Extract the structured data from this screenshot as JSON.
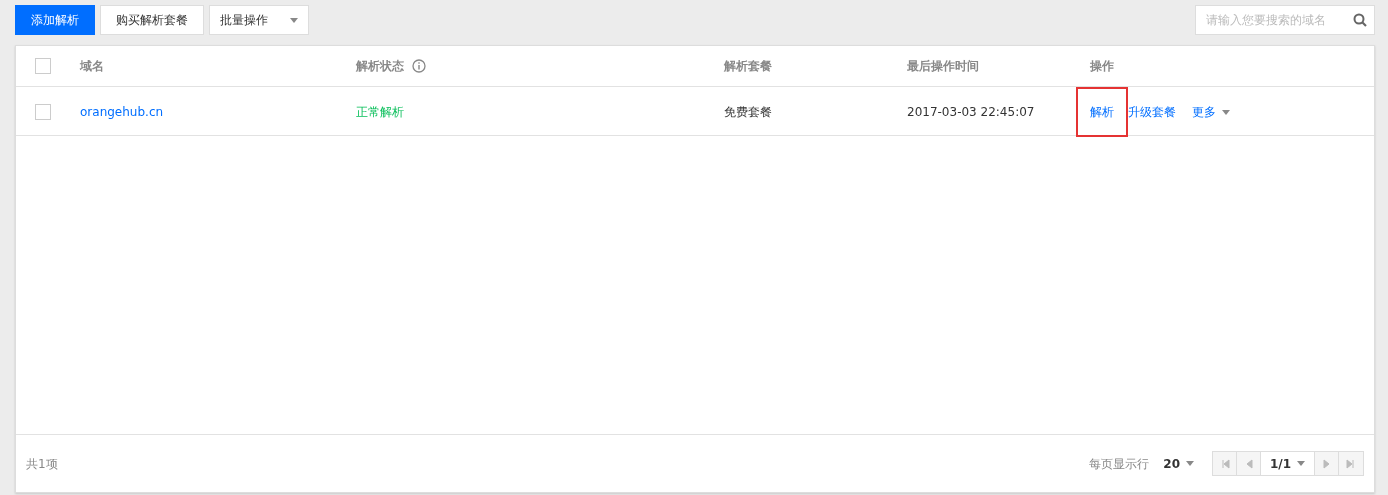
{
  "toolbar": {
    "primary_button": "添加解析",
    "secondary_button": "购买解析套餐",
    "batch_dropdown": "批量操作",
    "search": {
      "placeholder": "请输入您要搜索的域名"
    }
  },
  "table": {
    "select_all": {
      "checked": false
    },
    "columns": [
      "域名",
      "解析状态",
      "解析套餐",
      "最后操作时间",
      "操作"
    ],
    "rows": [
      {
        "checked": false,
        "domain": "orangehub.cn",
        "status": "正常解析",
        "plan": "免费套餐",
        "time": "2017-03-03 22:45:07",
        "actions": [
          {
            "label": "解析",
            "highlighted": true
          },
          {
            "label": "升级套餐",
            "highlighted": false
          }
        ],
        "more": "更多"
      }
    ]
  },
  "footer": {
    "total": "共1项",
    "page_size_label": "每页显示行",
    "page_size": "20",
    "page": "1/1"
  }
}
